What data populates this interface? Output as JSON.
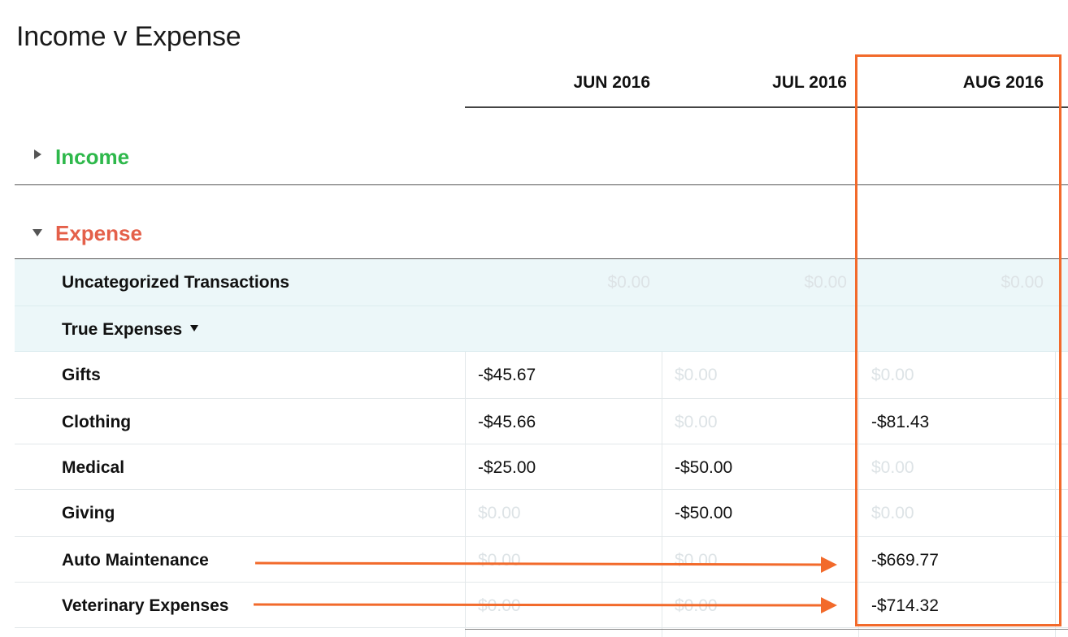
{
  "page": {
    "title": "Income v Expense"
  },
  "columns": [
    "JUN 2016",
    "JUL 2016",
    "AUG 2016"
  ],
  "sections": {
    "income": {
      "label": "Income",
      "color": "#2eb84b",
      "expanded": false
    },
    "expense": {
      "label": "Expense",
      "color": "#e4604a",
      "expanded": true
    }
  },
  "uncategorized": {
    "label": "Uncategorized Transactions",
    "values": [
      "$0.00",
      "$0.00",
      "$0.00"
    ]
  },
  "group": {
    "label": "True Expenses",
    "caret_icon": "caret-down-icon"
  },
  "rows": [
    {
      "label": "Gifts",
      "values": [
        "-$45.67",
        "$0.00",
        "$0.00"
      ]
    },
    {
      "label": "Clothing",
      "values": [
        "-$45.66",
        "$0.00",
        "-$81.43"
      ]
    },
    {
      "label": "Medical",
      "values": [
        "-$25.00",
        "-$50.00",
        "$0.00"
      ]
    },
    {
      "label": "Giving",
      "values": [
        "$0.00",
        "-$50.00",
        "$0.00"
      ]
    },
    {
      "label": "Auto Maintenance",
      "values": [
        "$0.00",
        "$0.00",
        "-$669.77"
      ]
    },
    {
      "label": "Veterinary Expenses",
      "values": [
        "$0.00",
        "$0.00",
        "-$714.32"
      ]
    }
  ],
  "annotation": {
    "highlight_color": "#f26a2b",
    "highlighted_column": "AUG 2016"
  }
}
